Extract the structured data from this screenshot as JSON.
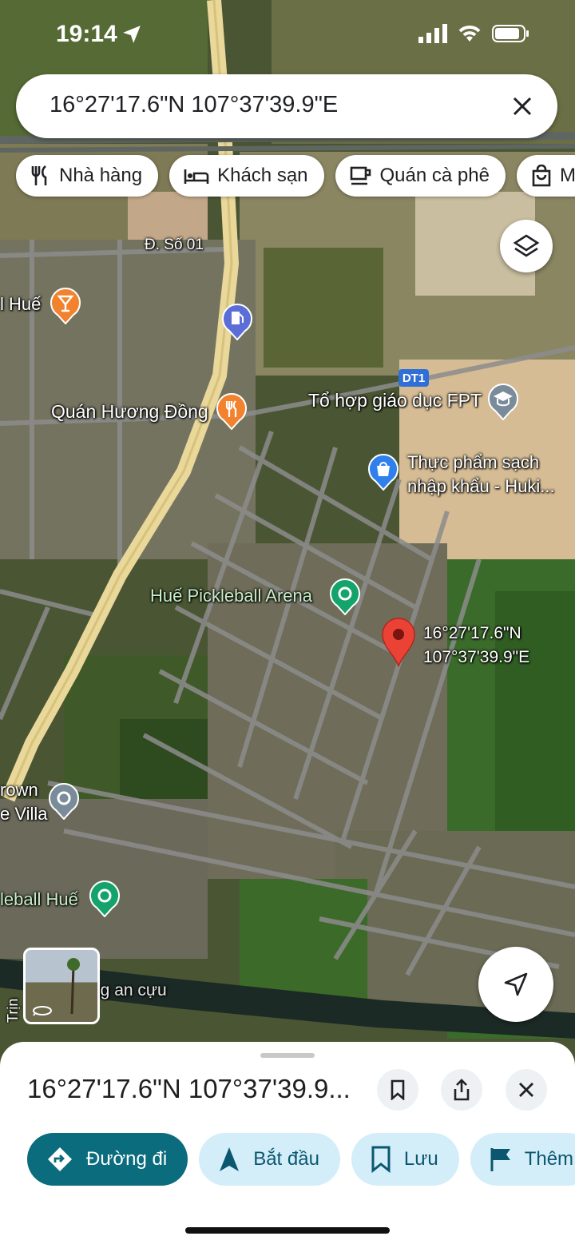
{
  "status_bar": {
    "time": "19:14"
  },
  "search": {
    "query": "16°27'17.6\"N 107°37'39.9\"E"
  },
  "chips": [
    "Nhà hàng",
    "Khách sạn",
    "Quán cà phê",
    "Mu"
  ],
  "map_labels": {
    "street_so01": "Đ. Số 01",
    "hue_partial": "l Huế",
    "quan_huong_dong": "Quán Hương Đồng",
    "dt1": "DT1",
    "fpt": "Tổ hợp giáo dục FPT",
    "thuc_pham_line1": "Thực phẩm sạch",
    "thuc_pham_line2": "nhập khẩu - Huki...",
    "pickleball_arena": "Huế Pickleball Arena",
    "pin_line1": "16°27'17.6\"N",
    "pin_line2": "107°37'39.9\"E",
    "crown_line1": "rown",
    "crown_line2": "e Villa",
    "pickleball_hue": "leball Huế",
    "an_cuu": "ng an cựu",
    "trinh": "Trịn"
  },
  "sheet": {
    "title": "16°27'17.6\"N 107°37'39.9...",
    "buttons": [
      "Đường đi",
      "Bắt đầu",
      "Lưu",
      "Thêm"
    ]
  },
  "colors": {
    "accent": "#0b6c7e",
    "pin": "#ea4335",
    "chip_bg": "#ffffff",
    "pill_bg": "#d3eef9"
  }
}
